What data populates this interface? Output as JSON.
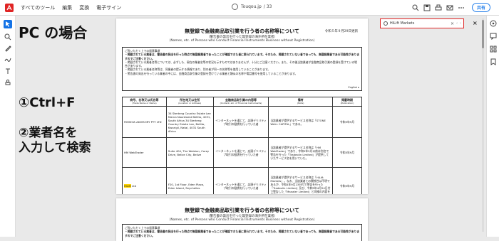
{
  "menubar": {
    "items": [
      "すべてのツール",
      "編集",
      "変換",
      "電子サイン"
    ],
    "file_name": "Touqou.jp",
    "file_suffix": "/ 33",
    "share_label": "共有"
  },
  "overlay": {
    "title": "PC の場合",
    "step1": "①Ctrl+F",
    "step2_line1": "②業者名を",
    "step2_line2": "入力して検索"
  },
  "search": {
    "value": "HiLift Markets",
    "clear_symbol": "×",
    "prev_symbol": "‹",
    "next_symbol": "›",
    "close_symbol": "×"
  },
  "document": {
    "title": "無登録で金融商品取引業を行う者の名称等について",
    "subtitle_jp": "（警告書の発出を行った無登録の海外所在業者）",
    "subtitle_en": "(Names, etc. of Persons who Conduct Financial Instruments Business without Registration)",
    "date": "令和５年９月29日更新",
    "notes": [
      "ご覧いただく上での留意事項",
      "・掲載されている業者は、警告書の発出を行った時点で無登録業者であったことが確認できた者に限られています。そのため、掲載されていない者であっても、無登録業者である可能性がありますのでご注意ください。",
      "・掲載されている業者名等については、必ずしも、現在の業者名等の状況を示すものではありませんが、十分にご注意ください。また、その後当該業者が金融商品取引業の登録を受けている場合があります。",
      "・掲載されている業者名称等は、同業者の提示する情報であり、別の者が同一の名称等を使用していることがあります。",
      "・警告書の発出を行っている業者の中には、金融商品取引業の登録を受けている業者と類似の名称や電話番号を使用していることがあります。"
    ],
    "notes_english": "English ▸",
    "headers": [
      {
        "jp": "商号、名称又は氏名等",
        "en": "(Trade Name or Name)"
      },
      {
        "jp": "所在地又は住所",
        "en": "(Location or Address)"
      },
      {
        "jp": "金融商品取引業の内容等",
        "en": "(Content, etc. of Financial Instruments)"
      },
      {
        "jp": "備考",
        "en": "(Note)"
      },
      {
        "jp": "掲載時期",
        "en": "(Publication)"
      }
    ],
    "rows": [
      {
        "name": "FINSEVA ADVISORY PTY LTD",
        "address": "34 Sterteng Country Estate Lee Marna Noordwest Bellito, 4031, South Africa\n34 Sterteng Country Estate Lee, Bellito, Kwarigil, Natal, 4031 South Africa",
        "business": "インターネットを通じて、店頭デリバティブ取引の勧誘を行っていた者",
        "note": "当該業者が提供するサービス名称は「STONE WALL CAPITAL」である。",
        "date": "令和5年9月"
      },
      {
        "name": "HM WebTrader",
        "address": "Suite 404, The Walston, Corey Drive, Belize City, Belize",
        "business": "インターネットを通じて、店頭デリバティブ取引の勧誘を行っていた者",
        "note": "当該業者が提供するサービス名称は「HM WebTrader」であり、令和5年5月以前は別名で警告を行った「Tradeolin Limited」が提供していたサービス名を用いていた。",
        "date": "令和5年9月"
      },
      {
        "name": "HiLift Markets Ltd",
        "name_highlight": "HiLift",
        "name_rest": " Ltd",
        "address": "F20, 1st Floor, Eden Plaza, Eden Island, Seychelles",
        "business": "インターネットを通じて、店頭デリバティブ取引の勧誘を行っていた者",
        "note": "当該業者が提供するサービス名称は「HiLift Markets」。なお、当該業者との関係性は不明であるが、令和4年9月23日付で警告を行った「Tradeolin Limited」及び、令和5年4月24日付で警告した「Manaler Limited」と同様の内容を表示していた。",
        "date": "令和5年9月"
      }
    ],
    "page2_title": "無登録で金融商品取引業を行う者の名称等について",
    "page2_sub_jp": "（警告書の発出を行った無登録の海外所在業者）",
    "page2_sub_en": "(Names, etc. of Persons who Conduct Financial Instruments Business without Registration)",
    "page2_note_head": "ご覧いただく上での留意事項",
    "page2_note_1": "・掲載されている業者は、警告書の発出を行った時点で無登録業者であったことが確認できた者に限られています。そのため、掲載されていない者であっても、無登録業者である可能性がありますのでご注意ください。"
  },
  "colors": {
    "accent": "#1473e6",
    "find_border": "#e02424",
    "highlight": "#ffd400"
  }
}
